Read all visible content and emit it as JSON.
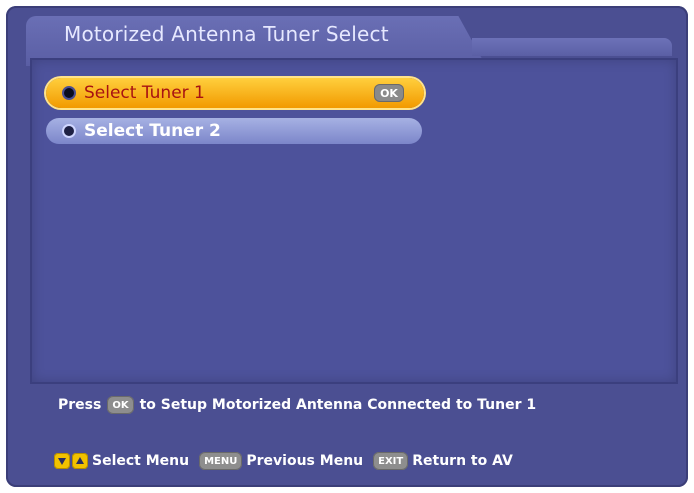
{
  "window": {
    "title": "Motorized Antenna Tuner Select"
  },
  "menu": {
    "items": [
      {
        "label": "Select Tuner 1",
        "selected": true,
        "ok_badge": "OK"
      },
      {
        "label": "Select Tuner 2",
        "selected": false
      }
    ]
  },
  "info": {
    "prefix": "Press",
    "ok_key": "OK",
    "suffix": "to Setup Motorized Antenna Connected to Tuner 1"
  },
  "help": {
    "select_menu_label": "Select Menu",
    "menu_key": "MENU",
    "previous_menu_label": "Previous Menu",
    "exit_key": "EXIT",
    "return_label": "Return to AV"
  },
  "icons": {
    "arrow_down": "triangle-down",
    "arrow_up": "triangle-up"
  },
  "colors": {
    "background": "#4b4f92",
    "selected_item": "#f29a00",
    "selected_text": "#a81212",
    "unselected_item": "#7c86ca",
    "title_text": "#e6e8ff"
  }
}
